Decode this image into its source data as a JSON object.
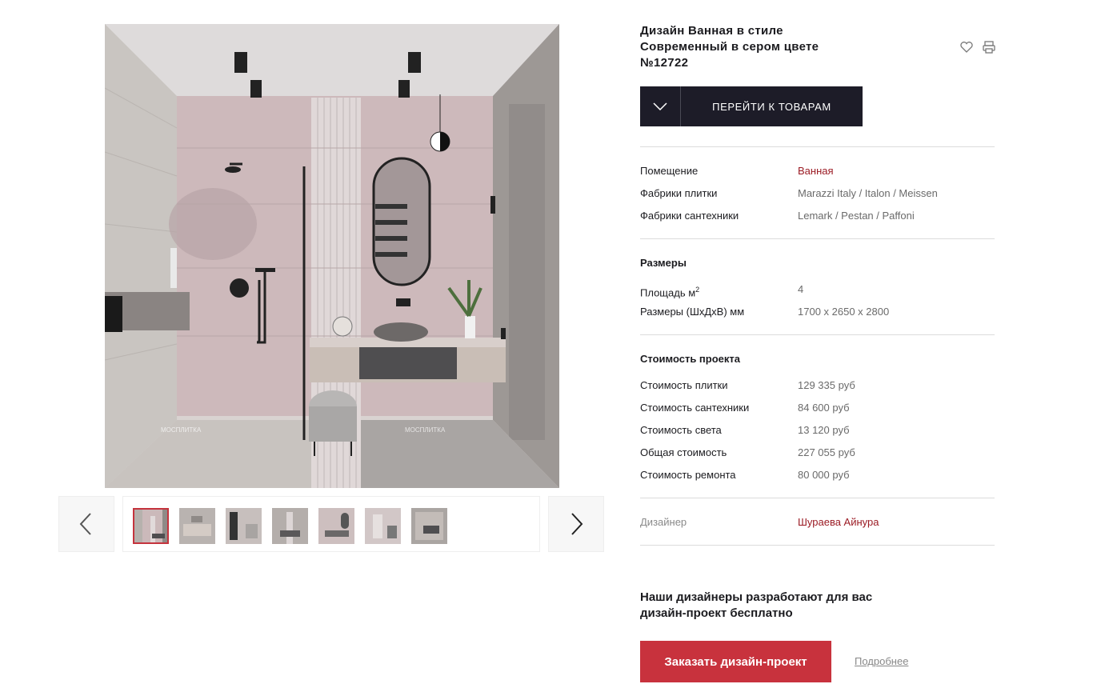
{
  "project": {
    "title_lines": [
      "Дизайн Ванная в стиле",
      "Современный в сером цвете",
      "№12722"
    ],
    "go_to_products": "ПЕРЕЙТИ К ТОВАРАМ"
  },
  "icons": {
    "favorite": "heart-icon",
    "print": "printer-icon",
    "dropdown": "chevron-down-icon",
    "prev": "chevron-left-icon",
    "next": "chevron-right-icon"
  },
  "info": [
    {
      "label": "Помещение",
      "value": "Ванная"
    },
    {
      "label": "Фабрики плитки",
      "value": "Marazzi Italy / Italon / Meissen"
    },
    {
      "label": "Фабрики сантехники",
      "value": "Lemark / Pestan / Paffoni"
    }
  ],
  "sizes": {
    "heading": "Размеры",
    "area_label": "Площадь м",
    "area_sup": "2",
    "area_value": "4",
    "dims_label": "Размеры (ШхДхВ) мм",
    "dims_value": "1700 х 2650 х 2800"
  },
  "cost": {
    "heading": "Стоимость проекта",
    "rows": [
      {
        "label": "Стоимость плитки",
        "value": "129 335 руб"
      },
      {
        "label": "Стоимость сантехники",
        "value": "84 600 руб"
      },
      {
        "label": "Стоимость света",
        "value": "13 120 руб"
      },
      {
        "label": "Общая стоимость",
        "value": "227 055 руб"
      },
      {
        "label": "Стоимость ремонта",
        "value": "80 000 руб"
      }
    ]
  },
  "designer": {
    "label": "Дизайнер",
    "name": "Шураева Айнура"
  },
  "promo": {
    "line1": "Наши дизайнеры разработают для вас",
    "line2": "дизайн-проект бесплатно",
    "order_button": "Заказать дизайн-проект",
    "more_link": "Подробнее"
  },
  "watermark": "МОСПЛИТКА",
  "colors": {
    "accent_red": "#c8323d",
    "dark_button": "#1d1c28",
    "link_red": "#9b1b24"
  },
  "gallery": {
    "thumb_count": 7,
    "active_index": 0
  }
}
